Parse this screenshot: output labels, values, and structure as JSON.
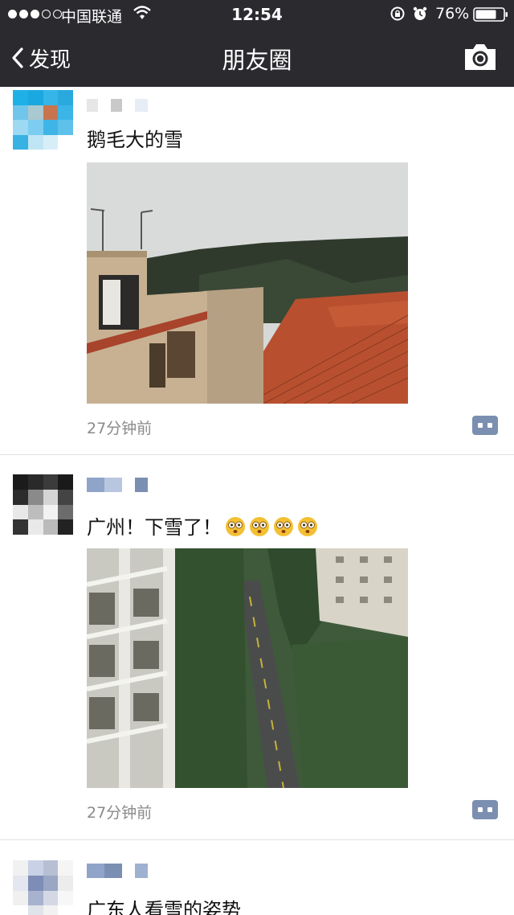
{
  "status_bar": {
    "carrier": "中国联通",
    "time": "12:54",
    "battery": "76%",
    "icons": [
      "signal-dots",
      "wifi-icon",
      "rotation-lock-icon",
      "alarm-icon",
      "battery-icon"
    ]
  },
  "nav": {
    "back_label": "发现",
    "title": "朋友圈",
    "right_icon": "camera-icon"
  },
  "posts": [
    {
      "text": "鹅毛大的雪",
      "time": "27分钟前",
      "photo": "rooftops-photo"
    },
    {
      "text": "广州！下雪了！",
      "emoji_count": 4,
      "time": "27分钟前",
      "photo": "street-view-photo"
    },
    {
      "text": "广东人看雪的姿势"
    }
  ],
  "colors": {
    "nav_bg": "#2a2a2f",
    "timestamp": "#8a8a8a",
    "comment_button": "#7b8fb0"
  }
}
